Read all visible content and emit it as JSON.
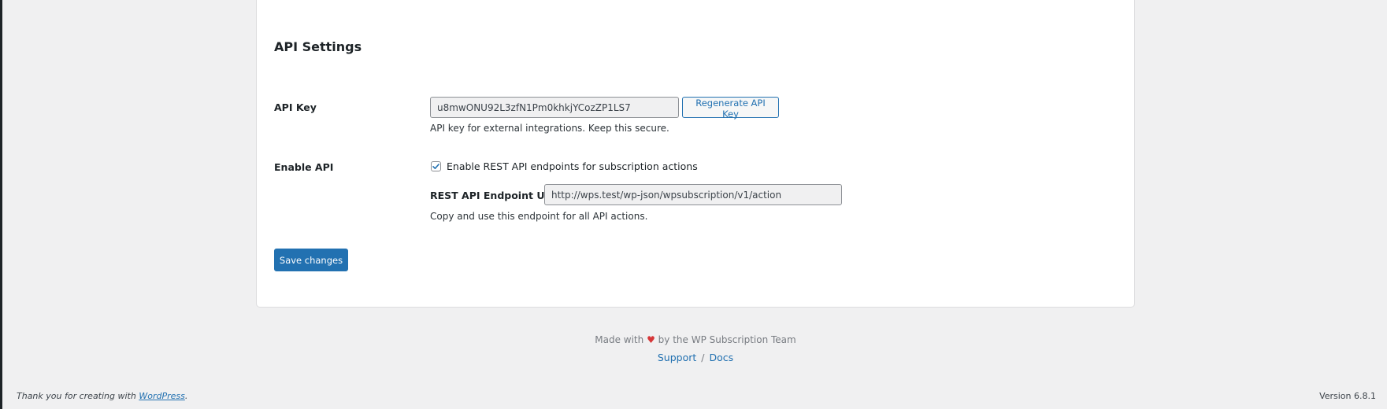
{
  "section": {
    "title": "API Settings"
  },
  "api_key": {
    "label": "API Key",
    "value": "u8mwONU92L3zfN1Pm0khkjYCozZP1LS7",
    "regenerate_label": "Regenerate API Key",
    "description": "API key for external integrations. Keep this secure."
  },
  "enable_api": {
    "label": "Enable API",
    "checked": true,
    "checkbox_label": "Enable REST API endpoints for subscription actions",
    "endpoint_label": "REST API Endpoint URL:",
    "endpoint_value": "http://wps.test/wp-json/wpsubscription/v1/action",
    "description": "Copy and use this endpoint for all API actions."
  },
  "save_label": "Save changes",
  "plugin_footer": {
    "made_prefix": "Made with",
    "heart": "♥",
    "made_suffix": "by the WP Subscription Team",
    "support": "Support",
    "separator": "/",
    "docs": "Docs"
  },
  "wp_footer": {
    "thanks_prefix": "Thank you for creating with",
    "wordpress": "WordPress",
    "thanks_suffix": ".",
    "version": "Version 6.8.1"
  },
  "colors": {
    "accent": "#2271b1",
    "background": "#f0f0f1",
    "heart": "#d63638"
  }
}
